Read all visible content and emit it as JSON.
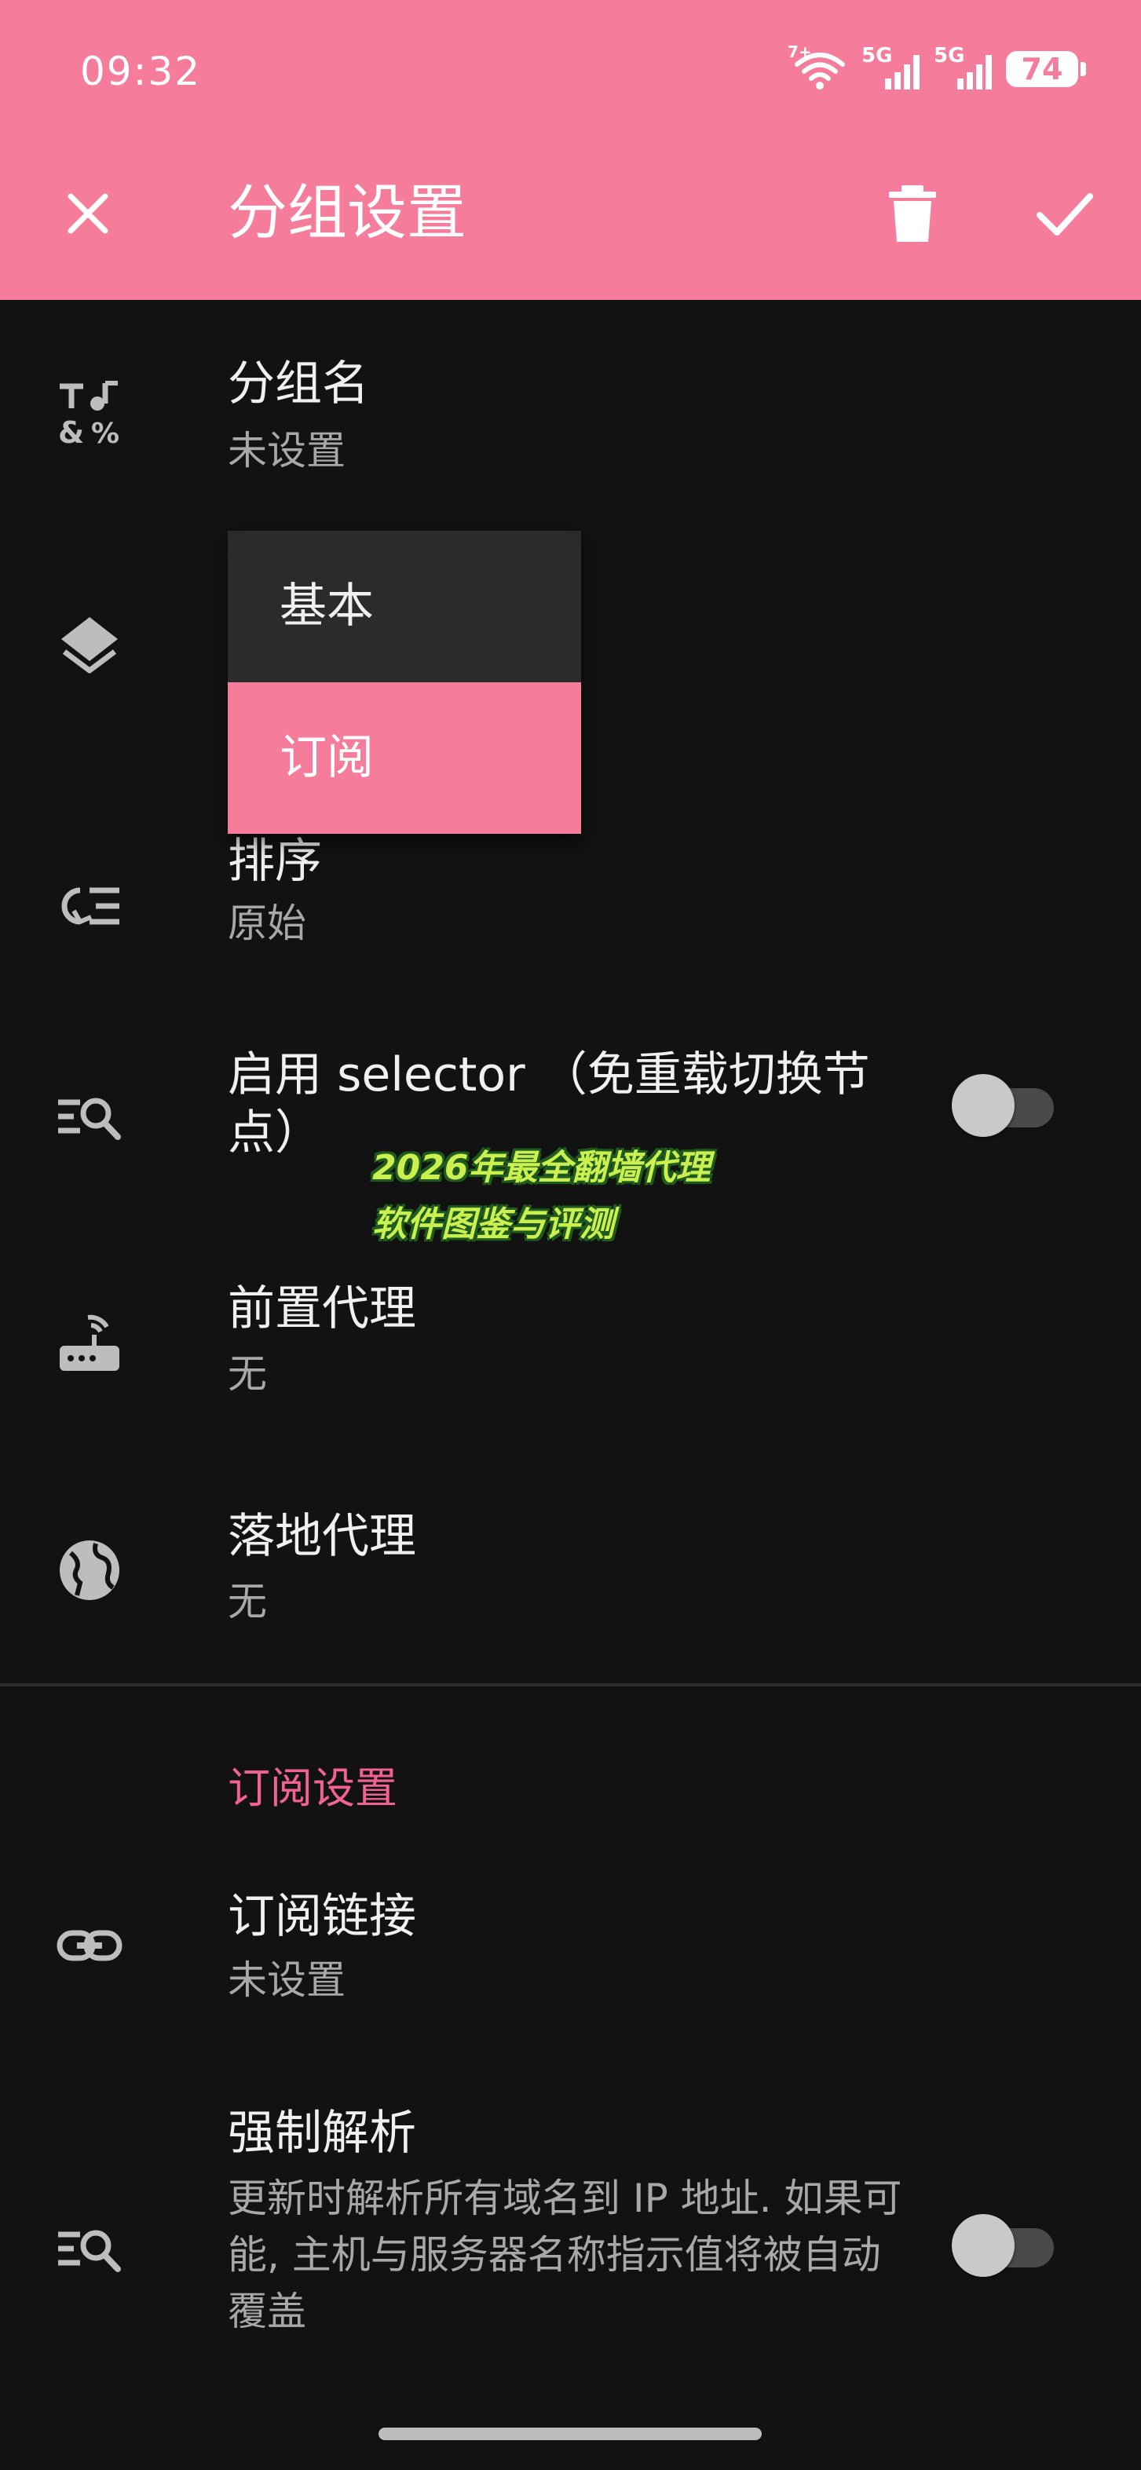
{
  "status_bar": {
    "time": "09:32",
    "net1": "5G",
    "net2": "5G",
    "wifi_badge": "7+",
    "battery": "74"
  },
  "app_bar": {
    "title": "分组设置",
    "accent_color": "#f67c9c"
  },
  "rows": {
    "group_name": {
      "title": "分组名",
      "value": "未设置"
    },
    "sort": {
      "title": "排序",
      "value": "原始"
    },
    "selector": {
      "title": "启用 selector （免重载切换节点）",
      "enabled": false
    },
    "front_proxy": {
      "title": "前置代理",
      "value": "无"
    },
    "landing_proxy": {
      "title": "落地代理",
      "value": "无"
    }
  },
  "type_menu": {
    "options": [
      "基本",
      "订阅"
    ],
    "selected": "订阅"
  },
  "subscription_section": {
    "header": "订阅设置",
    "link": {
      "title": "订阅链接",
      "value": "未设置"
    },
    "force_resolve": {
      "title": "强制解析",
      "desc": "更新时解析所有域名到 IP 地址. 如果可能, 主机与服务器名称指示值将被自动覆盖",
      "enabled": false
    }
  },
  "watermark": {
    "line1": "2026年最全翻墙代理",
    "line2": "软件图鉴与评测"
  }
}
